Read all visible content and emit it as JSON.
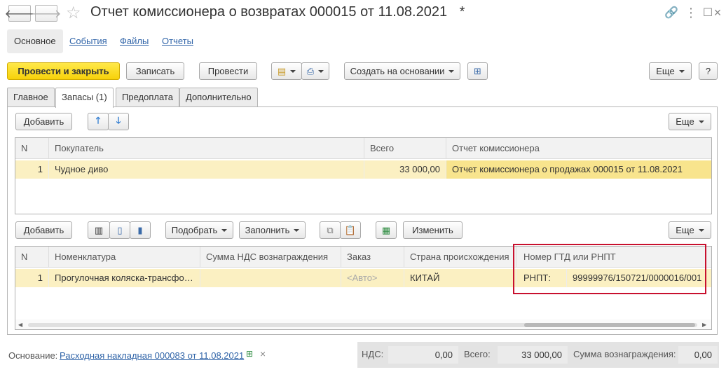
{
  "window": {
    "title": "Отчет комиссионера о возвратах 000015 от 11.08.2021",
    "modified_marker": "*"
  },
  "nav_tabs": [
    "Основное",
    "События",
    "Файлы",
    "Отчеты"
  ],
  "toolbar": {
    "post_close": "Провести и закрыть",
    "save": "Записать",
    "post": "Провести",
    "create_based": "Создать на основании",
    "more": "Еще",
    "help": "?"
  },
  "form_tabs": [
    "Главное",
    "Запасы (1)",
    "Предоплата",
    "Дополнительно"
  ],
  "top_grid": {
    "add_label": "Добавить",
    "more_label": "Еще",
    "columns": [
      "N",
      "Покупатель",
      "Всего",
      "Отчет комиссионера"
    ],
    "rows": [
      {
        "n": "1",
        "buyer": "Чудное диво",
        "total": "33 000,00",
        "report": "Отчет комиссионера о продажах 000015 от 11.08.2021"
      }
    ]
  },
  "bottom_grid": {
    "add_label": "Добавить",
    "pick_label": "Подобрать",
    "fill_label": "Заполнить",
    "change_label": "Изменить",
    "more_label": "Еще",
    "columns": [
      "N",
      "Номенклатура",
      "Сумма НДС вознаграждения",
      "Заказ",
      "Страна происхождения",
      "Номер ГТД или РНПТ"
    ],
    "rows": [
      {
        "n": "1",
        "item": "Прогулочная коляска-трансфо…",
        "vat": "",
        "order": "<Авто>",
        "country": "КИТАЙ",
        "gtd_prefix": "РНПТ:",
        "gtd_number": "99999976/150721/0000016/001"
      }
    ]
  },
  "footer": {
    "basis_label": "Основание:",
    "basis_link": "Расходная накладная 000083 от 11.08.2021",
    "vat_label": "НДС:",
    "vat_value": "0,00",
    "total_label": "Всего:",
    "total_value": "33 000,00",
    "reward_label": "Сумма вознаграждения:",
    "reward_value": "0,00"
  },
  "colors": {
    "accent": "#f7d20a",
    "row_highlight": "#fbf0c2",
    "selected_cell": "#f8e48d",
    "callout_border": "#c8102e",
    "link": "#3064a8"
  }
}
